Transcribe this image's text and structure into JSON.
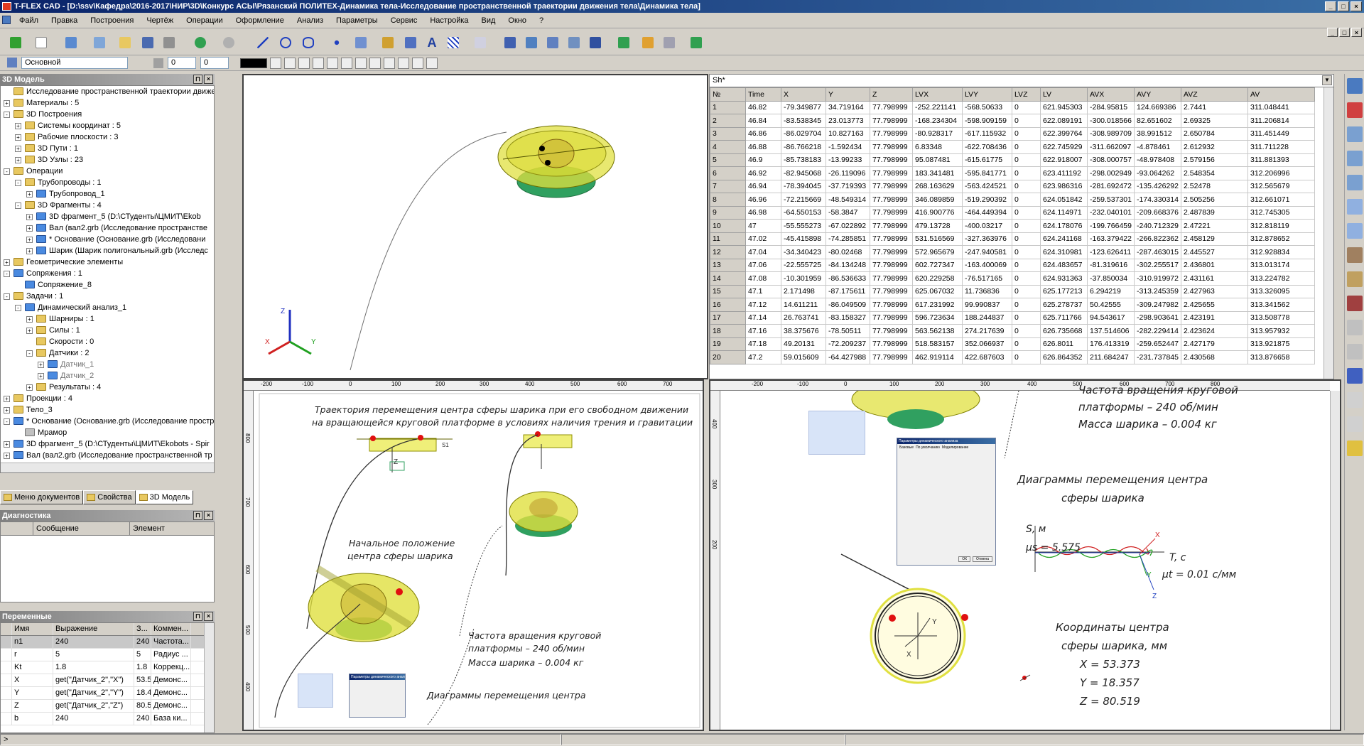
{
  "window": {
    "title": "T-FLEX CAD - [D:\\ssv\\Кафедра\\2016-2017\\НИР\\3D\\Конкурс АСЫ\\Рязанский ПОЛИТЕХ-Динамика тела-Исследование пространственной траектории движения тела\\Динамика тела]",
    "minimize": "_",
    "maximize": "□",
    "close": "×"
  },
  "menu": [
    "Файл",
    "Правка",
    "Построения",
    "Чертёж",
    "Операции",
    "Оформление",
    "Анализ",
    "Параметры",
    "Сервис",
    "Настройка",
    "Вид",
    "Окно",
    "?"
  ],
  "toolbar2": {
    "style": "Основной",
    "spin1": "0",
    "spin2": "0"
  },
  "tree": {
    "title": "3D Модель",
    "items": [
      {
        "label": "Исследование пространственной траектории движени",
        "level": 0,
        "exp": "",
        "icon": "model-root-icon"
      },
      {
        "label": "Материалы : 5",
        "level": 0,
        "exp": "+",
        "icon": "folder-icon"
      },
      {
        "label": "3D Построения",
        "level": 0,
        "exp": "-",
        "icon": "folder-icon"
      },
      {
        "label": "Системы координат : 5",
        "level": 1,
        "exp": "+",
        "icon": "folder-icon"
      },
      {
        "label": "Рабочие плоскости : 3",
        "level": 1,
        "exp": "+",
        "icon": "folder-icon"
      },
      {
        "label": "3D Пути : 1",
        "level": 1,
        "exp": "+",
        "icon": "folder-icon"
      },
      {
        "label": "3D Узлы : 23",
        "level": 1,
        "exp": "+",
        "icon": "folder-icon"
      },
      {
        "label": "Операции",
        "level": 0,
        "exp": "-",
        "icon": "folder-icon"
      },
      {
        "label": "Трубопроводы : 1",
        "level": 1,
        "exp": "-",
        "icon": "folder-icon"
      },
      {
        "label": "Трубопровод_1",
        "level": 2,
        "exp": "+",
        "icon": "pipe-icon"
      },
      {
        "label": "3D Фрагменты : 4",
        "level": 1,
        "exp": "-",
        "icon": "folder-icon"
      },
      {
        "label": "3D фрагмент_5 (D:\\СТуденты\\ЦМИТ\\Ekob",
        "level": 2,
        "exp": "+",
        "icon": "fragment-icon"
      },
      {
        "label": "Вал (вал2.grb (Исследование пространстве",
        "level": 2,
        "exp": "+",
        "icon": "fragment-icon"
      },
      {
        "label": "* Основание (Основание.grb (Исследовани",
        "level": 2,
        "exp": "+",
        "icon": "fragment-icon"
      },
      {
        "label": "Шарик (Шарик полигональный.grb (Исследс",
        "level": 2,
        "exp": "+",
        "icon": "fragment-icon"
      },
      {
        "label": "Геометрические элементы",
        "level": 0,
        "exp": "+",
        "icon": "folder-icon"
      },
      {
        "label": "Сопряжения : 1",
        "level": 0,
        "exp": "-",
        "icon": "constraint-icon"
      },
      {
        "label": "Сопряжение_8",
        "level": 1,
        "exp": "",
        "icon": "constraint-item-icon"
      },
      {
        "label": "Задачи : 1",
        "level": 0,
        "exp": "-",
        "icon": "tasks-icon"
      },
      {
        "label": "Динамический анализ_1",
        "level": 1,
        "exp": "-",
        "icon": "dynamic-analysis-icon"
      },
      {
        "label": "Шарниры : 1",
        "level": 2,
        "exp": "+",
        "icon": "folder-icon"
      },
      {
        "label": "Силы : 1",
        "level": 2,
        "exp": "+",
        "icon": "folder-icon"
      },
      {
        "label": "Скорости : 0",
        "level": 2,
        "exp": "",
        "icon": "folder-icon"
      },
      {
        "label": "Датчики : 2",
        "level": 2,
        "exp": "-",
        "icon": "folder-icon"
      },
      {
        "label": "Датчик_1",
        "level": 3,
        "exp": "+",
        "icon": "sensor-icon",
        "gray": true
      },
      {
        "label": "Датчик_2",
        "level": 3,
        "exp": "+",
        "icon": "sensor-icon",
        "gray": true
      },
      {
        "label": "Результаты : 4",
        "level": 2,
        "exp": "+",
        "icon": "folder-icon"
      },
      {
        "label": "Проекции : 4",
        "level": 0,
        "exp": "+",
        "icon": "folder-icon"
      },
      {
        "label": "Тело_3",
        "level": 0,
        "exp": "+",
        "icon": "body-icon"
      },
      {
        "label": "* Основание (Основание.grb (Исследование простр",
        "level": 0,
        "exp": "-",
        "icon": "fragment-icon"
      },
      {
        "label": "Мрамор",
        "level": 1,
        "exp": "",
        "icon": "material-icon"
      },
      {
        "label": "3D фрагмент_5 (D:\\СТуденты\\ЦМИТ\\Ekobots - Spir",
        "level": 0,
        "exp": "+",
        "icon": "fragment-icon"
      },
      {
        "label": "Вал (вал2.grb (Исследование пространственной тр",
        "level": 0,
        "exp": "+",
        "icon": "fragment-icon"
      },
      {
        "label": "Шарик (Шарик полигональный.grb (Исследование п",
        "level": 0,
        "exp": "+",
        "icon": "fragment-icon"
      }
    ]
  },
  "tabs": [
    "Меню документов",
    "Свойства",
    "3D Модель"
  ],
  "diag": {
    "title": "Диагностика",
    "cols": [
      "Сообщение",
      "Элемент"
    ]
  },
  "vars": {
    "title": "Переменные",
    "cols": [
      "",
      "Имя",
      "Выражение",
      "З...",
      "Коммен..."
    ],
    "rows": [
      [
        "",
        "n1",
        "240",
        "240",
        "Частота..."
      ],
      [
        "",
        "r",
        "5",
        "5",
        "Радиус ..."
      ],
      [
        "",
        "Kt",
        "1.8",
        "1.8",
        "Коррекц..."
      ],
      [
        "",
        "X",
        "get(\"Датчик_2\",\"X\")",
        "53.5...",
        "Демонс..."
      ],
      [
        "",
        "Y",
        "get(\"Датчик_2\",\"Y\")",
        "18.4...",
        "Демонс..."
      ],
      [
        "",
        "Z",
        "get(\"Датчик_2\",\"Z\")",
        "80.5...",
        "Демонс..."
      ],
      [
        "",
        "b",
        "240",
        "240",
        "База ки..."
      ]
    ]
  },
  "sheet": {
    "name": "Sh*",
    "cols": [
      "№",
      "Time",
      "X",
      "Y",
      "Z",
      "LVX",
      "LVY",
      "LVZ",
      "LV",
      "AVX",
      "AVY",
      "AVZ",
      "AV"
    ],
    "rows": [
      [
        "1",
        "46.82",
        "-79.349877",
        "34.719164",
        "77.798999",
        "-252.221141",
        "-568.50633",
        "0",
        "621.945303",
        "-284.95815",
        "124.669386",
        "2.7441",
        "311.048441"
      ],
      [
        "2",
        "46.84",
        "-83.538345",
        "23.013773",
        "77.798999",
        "-168.234304",
        "-598.909159",
        "0",
        "622.089191",
        "-300.018566",
        "82.651602",
        "2.69325",
        "311.206814"
      ],
      [
        "3",
        "46.86",
        "-86.029704",
        "10.827163",
        "77.798999",
        "-80.928317",
        "-617.115932",
        "0",
        "622.399764",
        "-308.989709",
        "38.991512",
        "2.650784",
        "311.451449"
      ],
      [
        "4",
        "46.88",
        "-86.766218",
        "-1.592434",
        "77.798999",
        "6.83348",
        "-622.708436",
        "0",
        "622.745929",
        "-311.662097",
        "-4.878461",
        "2.612932",
        "311.711228"
      ],
      [
        "5",
        "46.9",
        "-85.738183",
        "-13.99233",
        "77.798999",
        "95.087481",
        "-615.61775",
        "0",
        "622.918007",
        "-308.000757",
        "-48.978408",
        "2.579156",
        "311.881393"
      ],
      [
        "6",
        "46.92",
        "-82.945068",
        "-26.119096",
        "77.798999",
        "183.341481",
        "-595.841771",
        "0",
        "623.411192",
        "-298.002949",
        "-93.064262",
        "2.548354",
        "312.206996"
      ],
      [
        "7",
        "46.94",
        "-78.394045",
        "-37.719393",
        "77.798999",
        "268.163629",
        "-563.424521",
        "0",
        "623.986316",
        "-281.692472",
        "-135.426292",
        "2.52478",
        "312.565679"
      ],
      [
        "8",
        "46.96",
        "-72.215669",
        "-48.549314",
        "77.798999",
        "346.089859",
        "-519.290392",
        "0",
        "624.051842",
        "-259.537301",
        "-174.330314",
        "2.505256",
        "312.661071"
      ],
      [
        "9",
        "46.98",
        "-64.550153",
        "-58.3847",
        "77.798999",
        "416.900776",
        "-464.449394",
        "0",
        "624.114971",
        "-232.040101",
        "-209.668376",
        "2.487839",
        "312.745305"
      ],
      [
        "10",
        "47",
        "-55.555273",
        "-67.022892",
        "77.798999",
        "479.13728",
        "-400.03217",
        "0",
        "624.178076",
        "-199.766459",
        "-240.712329",
        "2.47221",
        "312.818119"
      ],
      [
        "11",
        "47.02",
        "-45.415898",
        "-74.285851",
        "77.798999",
        "531.516569",
        "-327.363976",
        "0",
        "624.241168",
        "-163.379422",
        "-266.822362",
        "2.458129",
        "312.878652"
      ],
      [
        "12",
        "47.04",
        "-34.340423",
        "-80.02468",
        "77.798999",
        "572.965679",
        "-247.940581",
        "0",
        "624.310981",
        "-123.626411",
        "-287.463015",
        "2.445527",
        "312.928834"
      ],
      [
        "13",
        "47.06",
        "-22.555725",
        "-84.134248",
        "77.798999",
        "602.727347",
        "-163.400069",
        "0",
        "624.483657",
        "-81.319616",
        "-302.255517",
        "2.436801",
        "313.013174"
      ],
      [
        "14",
        "47.08",
        "-10.301959",
        "-86.536633",
        "77.798999",
        "620.229258",
        "-76.517165",
        "0",
        "624.931363",
        "-37.850034",
        "-310.919972",
        "2.431161",
        "313.224782"
      ],
      [
        "15",
        "47.1",
        "2.171498",
        "-87.175611",
        "77.798999",
        "625.067032",
        "11.736836",
        "0",
        "625.177213",
        "6.294219",
        "-313.245359",
        "2.427963",
        "313.326095"
      ],
      [
        "16",
        "47.12",
        "14.611211",
        "-86.049509",
        "77.798999",
        "617.231992",
        "99.990837",
        "0",
        "625.278737",
        "50.42555",
        "-309.247982",
        "2.425655",
        "313.341562"
      ],
      [
        "17",
        "47.14",
        "26.763741",
        "-83.158327",
        "77.798999",
        "596.723634",
        "188.244837",
        "0",
        "625.711766",
        "94.543617",
        "-298.903641",
        "2.423191",
        "313.508778"
      ],
      [
        "18",
        "47.16",
        "38.375676",
        "-78.50511",
        "77.798999",
        "563.562138",
        "274.217639",
        "0",
        "626.735668",
        "137.514606",
        "-282.229414",
        "2.423624",
        "313.957932"
      ],
      [
        "19",
        "47.18",
        "49.20131",
        "-72.209237",
        "77.798999",
        "518.583157",
        "352.066937",
        "0",
        "626.8011",
        "176.413319",
        "-259.652447",
        "2.427179",
        "313.921875"
      ],
      [
        "20",
        "47.2",
        "59.015609",
        "-64.427988",
        "77.798999",
        "462.919114",
        "422.687603",
        "0",
        "626.864352",
        "211.684247",
        "-231.737845",
        "2.430568",
        "313.876658"
      ]
    ]
  },
  "drawL": {
    "ruler": [
      "-200",
      "-100",
      "0",
      "100",
      "200",
      "300",
      "400",
      "500",
      "600",
      "700"
    ],
    "ruler_v": [
      "800",
      "700",
      "600",
      "500",
      "400"
    ],
    "title1": "Траектория перемещения центра сферы шарика при его свободном движении",
    "title2": "на вращающейся круговой платформе в условиях наличия трения и гравитации",
    "start1": "Начальное положение",
    "start2": "центра сферы шарика",
    "freq1": "Частота вращения круговой",
    "freq2": "платформы – 240 об/мин",
    "mass": "Масса шарика – 0.004 кг",
    "diag": "Диаграммы перемещения центра",
    "z": "Z",
    "s1": "S1"
  },
  "drawR": {
    "ruler": [
      "-200",
      "-100",
      "0",
      "100",
      "200",
      "300",
      "400",
      "500",
      "600",
      "700",
      "800"
    ],
    "ruler_v": [
      "400",
      "300",
      "200"
    ],
    "freq1": "Частота вращения круговой",
    "freq2": "платформы – 240 об/мин",
    "mass": "Масса шарика – 0.004 кг",
    "diag1": "Диаграммы перемещения центра",
    "diag2": "сферы шарика",
    "s_axis": "S, м",
    "mu_s": "μs = 5.575",
    "t_axis": "T, с",
    "mu_t": "μt = 0.01 с/мм",
    "x_label": "X",
    "y_label": "Y",
    "z_label": "Z",
    "coord1": "Координаты центра",
    "coord2": "сферы шарика, мм",
    "cx": "X = 53.373",
    "cy": "Y = 18.357",
    "cz": "Z = 80.519"
  },
  "mini": {
    "title": "Параметры динамического анализа",
    "tabs": [
      "Базовые",
      "По умолчанию",
      "Моделирование"
    ],
    "ok": "ОК",
    "cancel": "Отмена"
  },
  "triad": {
    "x": "X",
    "y": "Y",
    "z": "Z"
  },
  "colors": {
    "accent": "#0a246a",
    "plate": "#d8d830",
    "stand": "#30a050",
    "ball": "#e01010"
  },
  "status": {
    "left": ">"
  }
}
